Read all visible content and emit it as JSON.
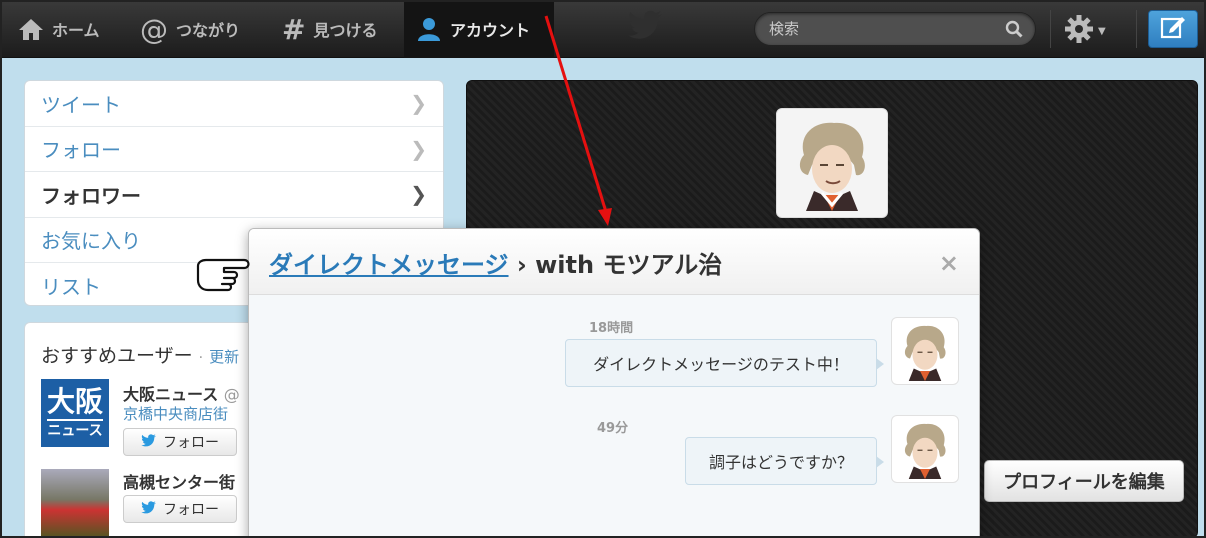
{
  "topbar": {
    "home_label": "ホーム",
    "connect_label": "つながり",
    "discover_label": "見つける",
    "account_label": "アカウント",
    "search_placeholder": "検索"
  },
  "sidebar": {
    "items": [
      {
        "label": "ツイート"
      },
      {
        "label": "フォロー"
      },
      {
        "label": "フォロワー"
      },
      {
        "label": "お気に入り"
      },
      {
        "label": "リスト"
      }
    ]
  },
  "suggestions": {
    "title": "おすすめユーザー",
    "separator": "·",
    "refresh_label": "更新",
    "users": [
      {
        "name": "大阪ニュース",
        "handle": "@",
        "desc": "京橋中央商店街",
        "follow_label": "フォロー",
        "avatar_top": "大阪",
        "avatar_bottom": "ニュース"
      },
      {
        "name": "高槻センター街",
        "handle": "",
        "desc": "",
        "follow_label": "フォロー"
      }
    ]
  },
  "profile": {
    "edit_label": "プロフィールを編集"
  },
  "dm_modal": {
    "title_link": "ダイレクトメッセージ",
    "title_rest": " › with モツアル治",
    "close_glyph": "×",
    "messages": [
      {
        "time": "18時間",
        "text": "ダイレクトメッセージのテスト中！"
      },
      {
        "time": "49分",
        "text": "調子はどうですか？"
      }
    ]
  },
  "colors": {
    "link": "#2a7ab8",
    "topbar": "#1c1c1c",
    "compose": "#3a8fce"
  }
}
